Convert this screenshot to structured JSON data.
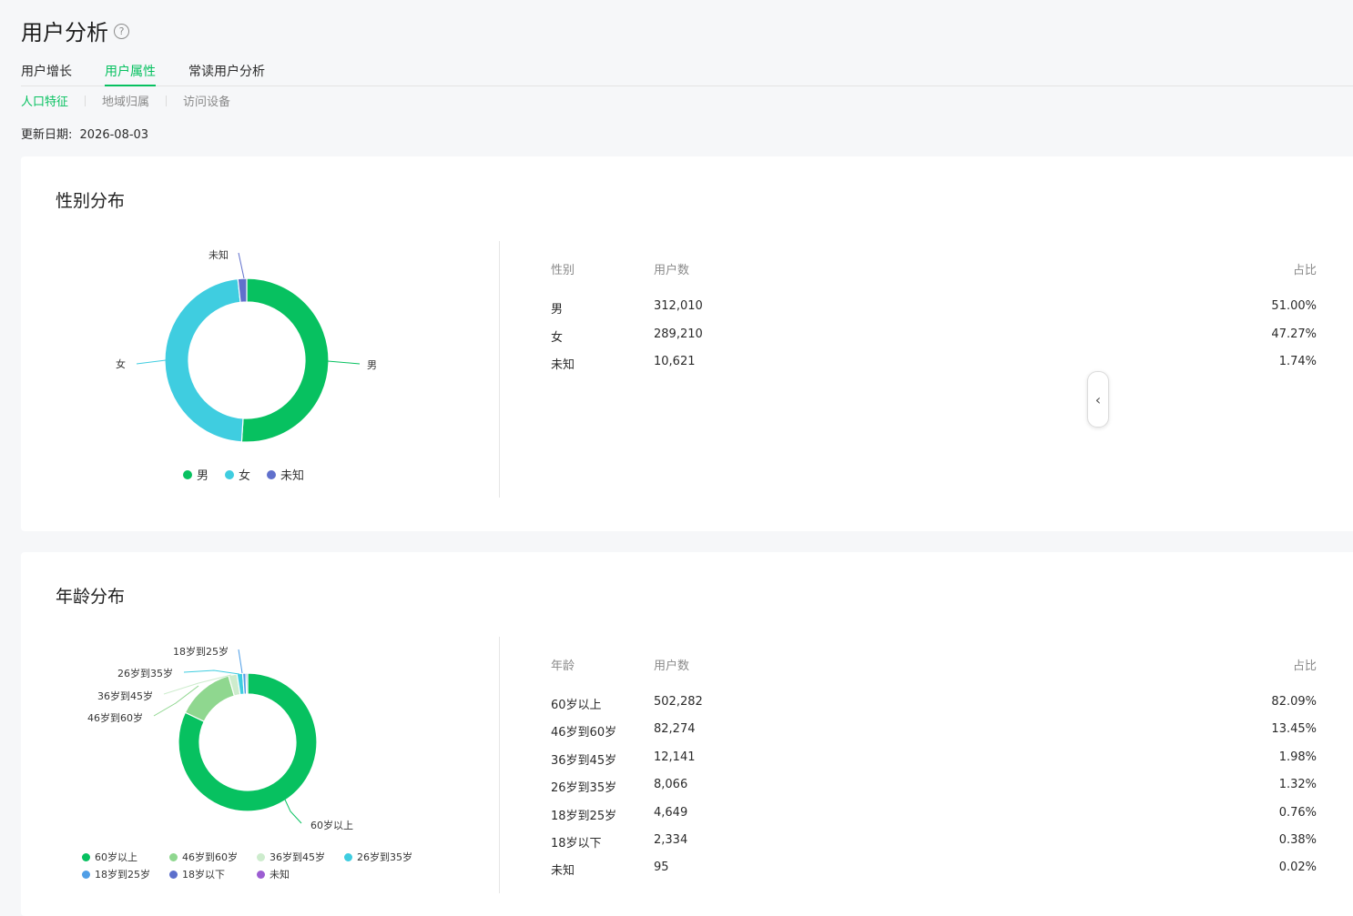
{
  "header": {
    "title": "用户分析",
    "help_glyph": "?"
  },
  "tabs": [
    {
      "label": "用户增长",
      "active": false
    },
    {
      "label": "用户属性",
      "active": true
    },
    {
      "label": "常读用户分析",
      "active": false
    }
  ],
  "subtabs": [
    {
      "label": "人口特征",
      "active": true
    },
    {
      "label": "地域归属",
      "active": false
    },
    {
      "label": "访问设备",
      "active": false
    }
  ],
  "update": {
    "label": "更新日期:",
    "value": "2026-08-03"
  },
  "colors": {
    "accent": "#07c160"
  },
  "gender": {
    "title": "性别分布",
    "table_headers": {
      "category": "性别",
      "users": "用户数",
      "ratio": "占比"
    },
    "rows": [
      {
        "label": "男",
        "users": "312,010",
        "ratio": "51.00%"
      },
      {
        "label": "女",
        "users": "289,210",
        "ratio": "47.27%"
      },
      {
        "label": "未知",
        "users": "10,621",
        "ratio": "1.74%"
      }
    ]
  },
  "age": {
    "title": "年龄分布",
    "table_headers": {
      "category": "年龄",
      "users": "用户数",
      "ratio": "占比"
    },
    "rows": [
      {
        "label": "60岁以上",
        "users": "502,282",
        "ratio": "82.09%"
      },
      {
        "label": "46岁到60岁",
        "users": "82,274",
        "ratio": "13.45%"
      },
      {
        "label": "36岁到45岁",
        "users": "12,141",
        "ratio": "1.98%"
      },
      {
        "label": "26岁到35岁",
        "users": "8,066",
        "ratio": "1.32%"
      },
      {
        "label": "18岁到25岁",
        "users": "4,649",
        "ratio": "0.76%"
      },
      {
        "label": "18岁以下",
        "users": "2,334",
        "ratio": "0.38%"
      },
      {
        "label": "未知",
        "users": "95",
        "ratio": "0.02%"
      }
    ]
  },
  "collapse_glyph": "‹",
  "chart_data": [
    {
      "type": "pie",
      "title": "性别分布",
      "categories": [
        "男",
        "女",
        "未知"
      ],
      "values": [
        312010,
        289210,
        10621
      ],
      "colors": [
        "#07c160",
        "#3fcde0",
        "#6070cc"
      ],
      "legend": "bottom"
    },
    {
      "type": "pie",
      "title": "年龄分布",
      "categories": [
        "60岁以上",
        "46岁到60岁",
        "36岁到45岁",
        "26岁到35岁",
        "18岁到25岁",
        "18岁以下",
        "未知"
      ],
      "values": [
        502282,
        82274,
        12141,
        8066,
        4649,
        2334,
        95
      ],
      "colors": [
        "#07c160",
        "#8fd78f",
        "#cdeccd",
        "#3fcde0",
        "#4f9ee6",
        "#5c6fcc",
        "#9c5dd2"
      ],
      "legend": "bottom"
    }
  ]
}
